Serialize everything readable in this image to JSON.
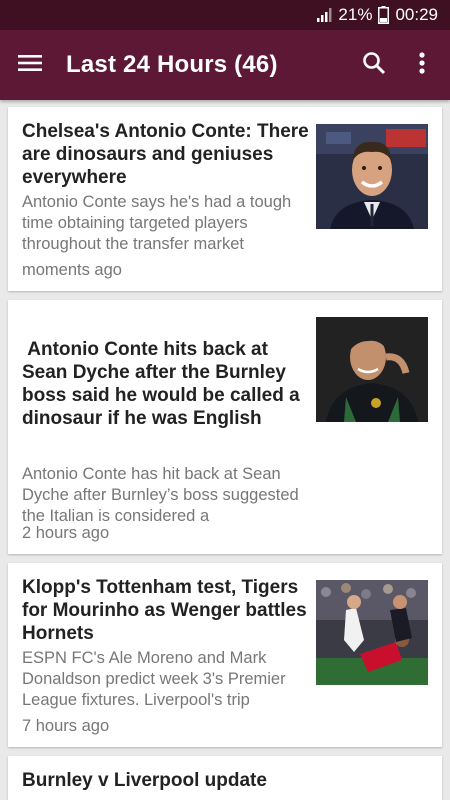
{
  "status_bar": {
    "battery": "21%",
    "clock": "00:29",
    "icons": [
      "signal-icon",
      "battery-icon"
    ]
  },
  "app_bar": {
    "title": "Last 24 Hours (46)",
    "icons": [
      "hamburger-menu-icon",
      "search-icon",
      "overflow-menu-icon"
    ]
  },
  "colors": {
    "status_bar": "#3f0f22",
    "app_bar": "#5d1836",
    "background": "#e9e9e9",
    "card": "#ffffff",
    "headline": "#222222",
    "secondary_text": "#777777"
  },
  "articles": [
    {
      "headline": "Chelsea's Antonio Conte: There are dinosaurs and geniuses everywhere",
      "summary": "Antonio Conte says he's had a tough time obtaining targeted players throughout the transfer market",
      "time": "moments ago"
    },
    {
      "headline": " Antonio Conte hits back at Sean Dyche after the Burnley boss said he would be called a dinosaur if he was English",
      "summary": "Antonio Conte has hit back at Sean Dyche after Burnley’s boss suggested the Italian is considered a",
      "time": "2 hours ago"
    },
    {
      "headline": "Klopp's Tottenham test, Tigers for Mourinho as Wenger battles Hornets",
      "summary": "ESPN FC's Ale Moreno and Mark Donaldson predict week 3's Premier League fixtures. Liverpool's trip",
      "time": "7 hours ago"
    },
    {
      "headline": "Burnley v Liverpool update",
      "summary": "",
      "time": ""
    }
  ]
}
